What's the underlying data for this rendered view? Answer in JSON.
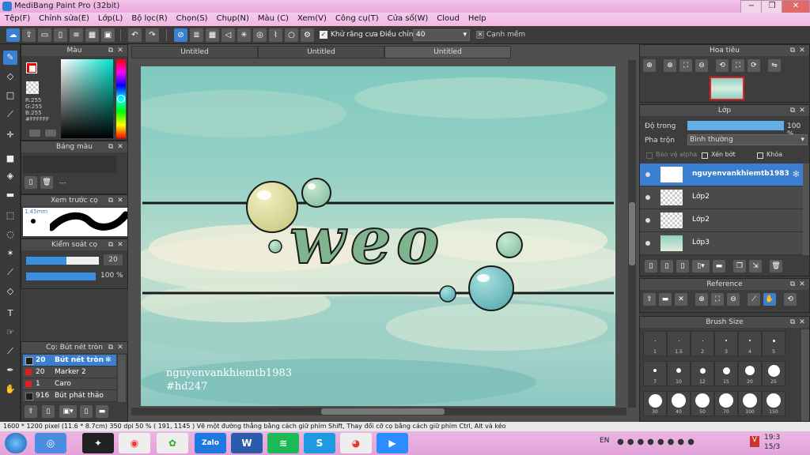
{
  "window": {
    "title": "MediBang Paint Pro (32bit)",
    "min": "−",
    "max": "❐",
    "close": "✕"
  },
  "menu": [
    "Tệp(F)",
    "Chỉnh sửa(E)",
    "Lớp(L)",
    "Bộ lọc(R)",
    "Chọn(S)",
    "Chụp(N)",
    "Màu (C)",
    "Xem(V)",
    "Công cụ(T)",
    "Cửa sổ(W)",
    "Cloud",
    "Help"
  ],
  "toolbar": {
    "antialias_label": "Khử răng cưa",
    "adjust_label": "Điều chỉnh",
    "adjust_value": "40",
    "smooth_label": "Cạnh mềm"
  },
  "color_panel": {
    "title": "Màu",
    "r": "R:255",
    "g": "G:255",
    "b": "B:255",
    "hex": "#FFFFFF"
  },
  "palette_panel": {
    "title": "Bảng màu",
    "value": "---"
  },
  "preview_panel": {
    "title": "Xem trước cọ",
    "size": "1.45mm"
  },
  "brush_control": {
    "title": "Kiểm soát cọ",
    "size": "20",
    "opacity": "100 %",
    "size_fill": 0.55,
    "opacity_fill": 1.0
  },
  "brush_panel": {
    "title": "Cọ: Bút nét tròn",
    "items": [
      {
        "size": "20",
        "name": "Bút nét tròn",
        "color": "#1e1e1e",
        "selected": true
      },
      {
        "size": "20",
        "name": "Marker 2",
        "color": "#e02020"
      },
      {
        "size": "1",
        "name": "Caro",
        "color": "#e02020"
      },
      {
        "size": "916",
        "name": "Bút phát thảo",
        "color": "#1e1e1e"
      }
    ]
  },
  "document_tabs": [
    "Untitled",
    "Untitled",
    "Untitled"
  ],
  "artwork": {
    "text": "weo",
    "credit_name": "nguyenvankhiemtb1983",
    "credit_tag": "#hd247"
  },
  "navigator": {
    "title": "Hoa tiêu"
  },
  "layer_panel": {
    "title": "Lớp",
    "opacity_label": "Độ trong",
    "opacity_value": "100 %",
    "opacity_fill": 1.0,
    "blend_label": "Pha trộn",
    "blend_value": "Bình thường",
    "protect_alpha": "Bảo vệ alpha",
    "clipping": "Xén bớt",
    "lock": "Khóa",
    "layers": [
      {
        "name": "nguyenvankhiemtb1983",
        "selected": true
      },
      {
        "name": "Lớp2"
      },
      {
        "name": "Lớp2"
      },
      {
        "name": "Lớp3"
      }
    ]
  },
  "reference_panel": {
    "title": "Reference"
  },
  "brush_size_panel": {
    "title": "Brush Size",
    "rows": [
      [
        "1",
        "1.5",
        "2",
        "3",
        "4",
        "5"
      ],
      [
        "7",
        "10",
        "12",
        "15",
        "20",
        "25"
      ],
      [
        "30",
        "40",
        "50",
        "70",
        "100",
        "150"
      ]
    ]
  },
  "status": {
    "text": "1600 * 1200 pixel  (11.6 * 8.7cm)  350 dpi  50 %  ( 191, 1145 )  Vẽ một đường thẳng bằng cách giữ phím Shift, Thay đổi cỡ cọ bằng cách giữ phím Ctrl, Alt và kéo"
  },
  "taskbar": {
    "lang": "EN",
    "time": "19:3",
    "date": "15/3",
    "apps": [
      "Zalo",
      "W",
      "S"
    ]
  }
}
